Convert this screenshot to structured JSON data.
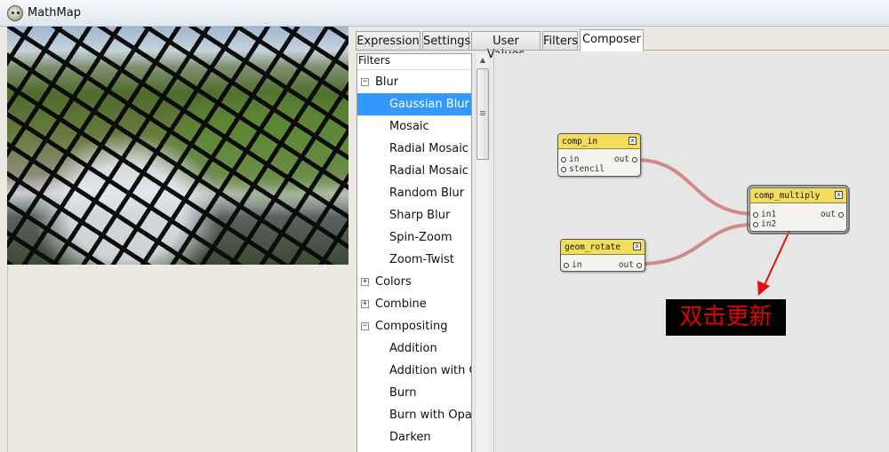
{
  "window": {
    "title": "MathMap"
  },
  "tabs": [
    "Expression",
    "Settings",
    "User Values",
    "Filters",
    "Composer"
  ],
  "filters": {
    "header": "Filters",
    "tree": [
      {
        "label": "Blur",
        "type": "group",
        "expander": "−"
      },
      {
        "label": "Gaussian Blur",
        "type": "item",
        "selected": true
      },
      {
        "label": "Mosaic",
        "type": "item"
      },
      {
        "label": "Radial Mosaic",
        "type": "item"
      },
      {
        "label": "Radial Mosaic B",
        "type": "item"
      },
      {
        "label": "Random Blur",
        "type": "item"
      },
      {
        "label": "Sharp Blur",
        "type": "item"
      },
      {
        "label": "Spin-Zoom",
        "type": "item"
      },
      {
        "label": "Zoom-Twist",
        "type": "item"
      },
      {
        "label": "Colors",
        "type": "group",
        "expander": "+"
      },
      {
        "label": "Combine",
        "type": "group",
        "expander": "+"
      },
      {
        "label": "Compositing",
        "type": "group",
        "expander": "−"
      },
      {
        "label": "Addition",
        "type": "item"
      },
      {
        "label": "Addition with Op",
        "type": "item"
      },
      {
        "label": "Burn",
        "type": "item"
      },
      {
        "label": "Burn with Opaci",
        "type": "item"
      },
      {
        "label": "Darken",
        "type": "item"
      }
    ]
  },
  "composer": {
    "nodes": {
      "comp_in": {
        "title": "comp_in",
        "close": "x",
        "inputs": [
          "in",
          "stencil"
        ],
        "outputs": [
          "out"
        ]
      },
      "geom_rotate": {
        "title": "geom_rotate",
        "close": "x",
        "inputs": [
          "in"
        ],
        "outputs": [
          "out"
        ]
      },
      "comp_multiply": {
        "title": "comp_multiply",
        "close": "x",
        "inputs": [
          "in1",
          "in2"
        ],
        "outputs": [
          "out"
        ]
      }
    },
    "annotation": "双击更新",
    "colors": {
      "node_title": "#f3dd5c",
      "wire": "#d57a7a",
      "arrow": "#e01010",
      "selection": "#3399ff"
    }
  }
}
